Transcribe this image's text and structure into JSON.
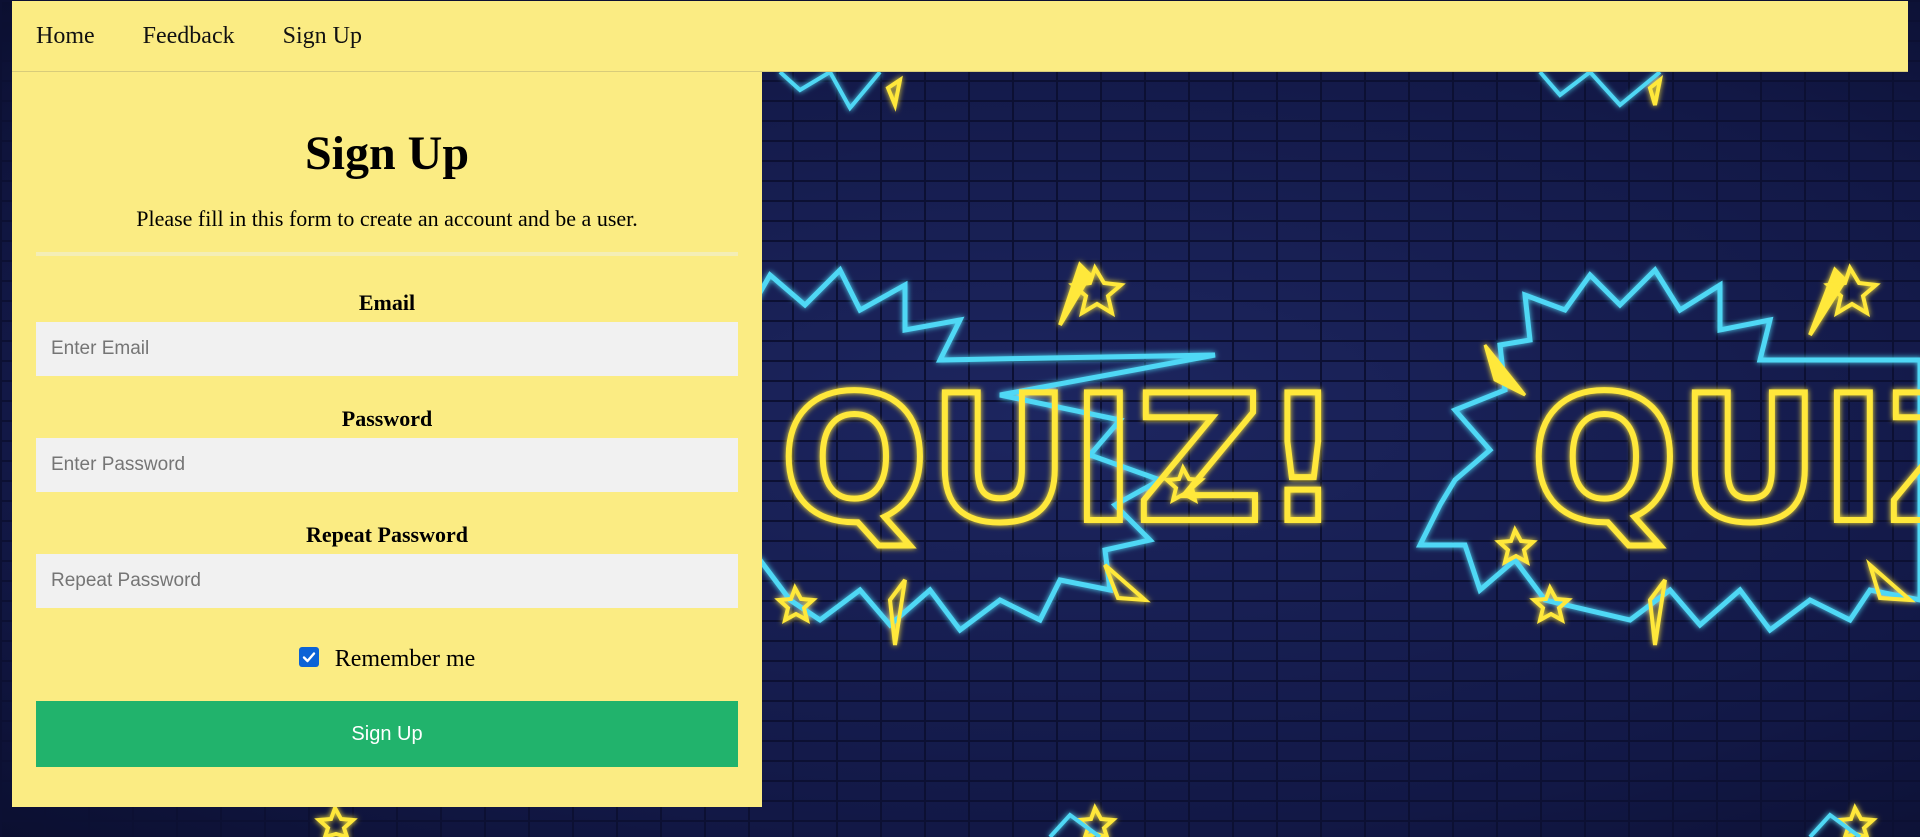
{
  "nav": {
    "items": [
      {
        "label": "Home"
      },
      {
        "label": "Feedback"
      },
      {
        "label": "Sign Up"
      }
    ]
  },
  "form": {
    "title": "Sign Up",
    "subtitle": "Please fill in this form to create an account and be a user.",
    "email": {
      "label": "Email",
      "placeholder": "Enter Email",
      "value": ""
    },
    "password": {
      "label": "Password",
      "placeholder": "Enter Password",
      "value": ""
    },
    "repeat_password": {
      "label": "Repeat Password",
      "placeholder": "Repeat Password",
      "value": ""
    },
    "remember": {
      "label": "Remember me",
      "checked": true
    },
    "submit_label": "Sign Up"
  },
  "background": {
    "badge_text": "QUIZ!",
    "icon": "quiz-burst-icon"
  },
  "colors": {
    "panel": "#fbec83",
    "button": "#21b36c",
    "checkbox": "#0b63d6",
    "input_bg": "#f1f1f1",
    "background": "#141a45",
    "neon_yellow": "#ffe83a",
    "neon_cyan": "#4fd8f5"
  }
}
